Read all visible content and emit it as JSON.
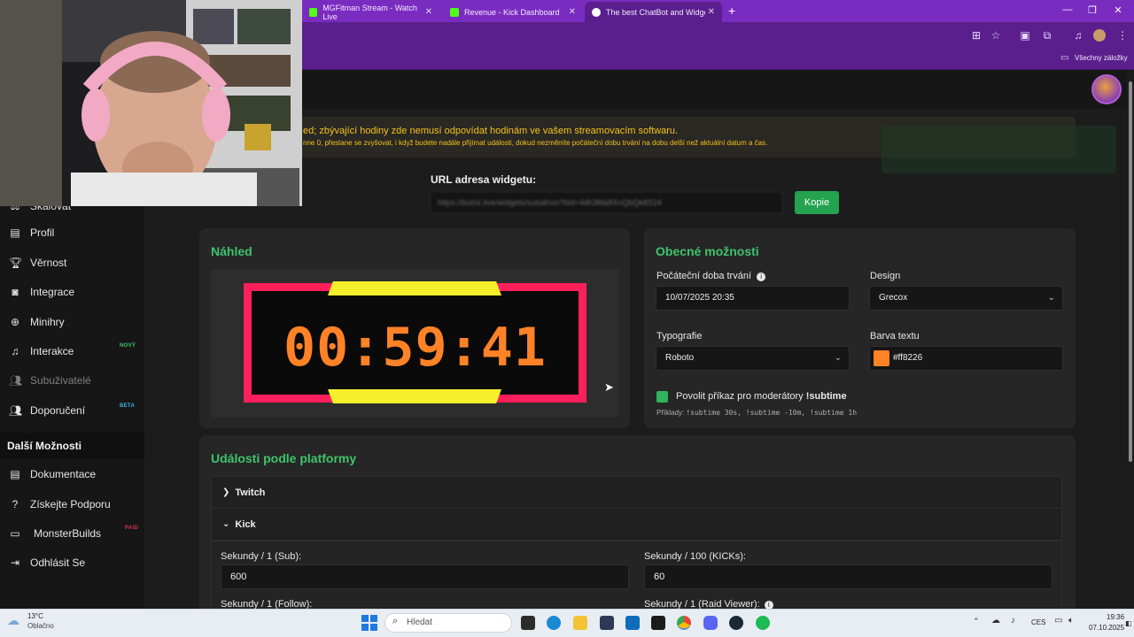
{
  "browser": {
    "tabs": [
      {
        "label": "MGFitman Stream - Watch Live",
        "favicon_color": "#53fc18"
      },
      {
        "label": "Revenue - Kick Dashboard",
        "favicon_color": "#53fc18"
      },
      {
        "label": "The best ChatBot and Widgets",
        "favicon_color": "#ffffff"
      }
    ],
    "new_tab_symbol": "+",
    "bookmarks_label": "Všechny záložky"
  },
  "sidebar": {
    "partial_item": "Škálovat",
    "items": [
      {
        "label": "Profil",
        "icon": "id-card-icon"
      },
      {
        "label": "Věrnost",
        "icon": "trophy-icon"
      },
      {
        "label": "Integrace",
        "icon": "plug-icon"
      },
      {
        "label": "Minihry",
        "icon": "gamepad-icon"
      },
      {
        "label": "Interakce",
        "icon": "music-icon",
        "badge": "NOVÝ"
      },
      {
        "label": "Subuživatelé",
        "icon": "users-icon"
      },
      {
        "label": "Doporučení",
        "icon": "referral-icon",
        "badge": "BETA"
      }
    ],
    "section_title": "Další Možnosti",
    "section_items": [
      {
        "label": "Dokumentace",
        "icon": "document-icon"
      },
      {
        "label": "Získejte Podporu",
        "icon": "help-icon"
      },
      {
        "label": "MonsterBuilds",
        "icon": "laptop-icon",
        "badge": "PAID"
      },
      {
        "label": "Odhlásit Se",
        "icon": "logout-icon"
      }
    ]
  },
  "alert": {
    "line1": "ed; zbývající hodiny zde nemusí odpovídat hodinám ve vašem streamovacím softwaru.",
    "line2": "nne 0, přestane se zvyšovat, i když budete nadále přijímat události, dokud nezměníte počáteční dobu trvání na dobu delší než aktuální datum a čas."
  },
  "widget_url": {
    "label": "URL adresa widgetu:",
    "value": "https://botrix.live/widgets/subathon?bid=4dh3Ma8XnQbQk8S24",
    "copy_button": "Kopie"
  },
  "preview": {
    "title": "Náhled",
    "timer": "00:59:41"
  },
  "general": {
    "title": "Obecné možnosti",
    "start_duration_label": "Počáteční doba trvání",
    "start_duration_value": "10/07/2025 20:35",
    "design_label": "Design",
    "design_value": "Grecox",
    "typography_label": "Typografie",
    "typography_value": "Roboto",
    "text_color_label": "Barva textu",
    "text_color_value": "#ff8226",
    "mod_command_label": "Povolit příkaz pro moderátory",
    "mod_command_name": "!subtime",
    "examples_label": "Příklady:",
    "examples_value": "!subtime 30s, !subtime -10m, !subtime 1h"
  },
  "platform_events": {
    "title": "Události podle platformy",
    "sections": [
      "Twitch",
      "Kick"
    ],
    "fields": [
      {
        "label": "Sekundy / 1 (Sub):",
        "value": "600"
      },
      {
        "label": "Sekundy / 100 (KICKs):",
        "value": "60"
      },
      {
        "label": "Sekundy / 1 (Follow):",
        "value": ""
      },
      {
        "label": "Sekundy / 1 (Raid Viewer):",
        "value": ""
      }
    ]
  },
  "taskbar": {
    "weather_temp": "13°C",
    "weather_desc": "Oblačno",
    "search_placeholder": "Hledat",
    "language": "CES",
    "time": "19:36",
    "date": "07.10.2025"
  },
  "colors": {
    "accent_green": "#3fc46b",
    "timer_orange": "#ff8226",
    "timer_frame": "#ff1f5a",
    "timer_bars": "#f6f02a",
    "browser_purple": "#7a2cc0"
  }
}
